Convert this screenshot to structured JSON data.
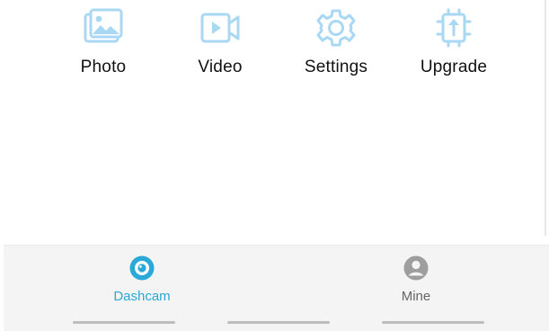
{
  "colors": {
    "icon_accent": "#a8d8f4",
    "active_tab": "#2aa8d8",
    "inactive_tab": "#9e9e9e",
    "nav_background": "#f4f4f4"
  },
  "functions": [
    {
      "label": "Photo",
      "icon": "photo-icon"
    },
    {
      "label": "Video",
      "icon": "video-icon"
    },
    {
      "label": "Settings",
      "icon": "gear-icon"
    },
    {
      "label": "Upgrade",
      "icon": "upgrade-chip-icon"
    }
  ],
  "bottom_nav": {
    "items": [
      {
        "label": "Dashcam",
        "icon": "dashcam-icon",
        "active": true
      },
      {
        "label": "Mine",
        "icon": "user-icon",
        "active": false
      }
    ]
  }
}
